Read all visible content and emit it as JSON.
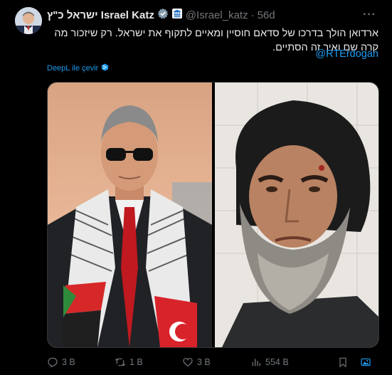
{
  "tweet": {
    "author_name": "ישראל כ\"ץ Israel Katz",
    "handle": "@Israel_katz",
    "separator": "·",
    "time": "56d",
    "more_glyph": "···",
    "text": "ארדואן הולך בדרכו של סדאם חוסיין ומאיים לתקוף את ישראל. רק שיזכור מה קרה שם ואיך זה הסתיים.",
    "mention": "@RTErdogan",
    "translate_label": "DeepL ile çevir"
  },
  "media": {
    "left_photo_icon": "photo-erdogan",
    "right_photo_icon": "photo-saddam"
  },
  "actions": {
    "replies": "3 B",
    "retweets": "1 B",
    "likes": "3 B",
    "views": "554 B"
  },
  "colors": {
    "background": "#000000",
    "text": "#e7e9ea",
    "muted": "#71767b",
    "accent": "#1d9bf0"
  }
}
